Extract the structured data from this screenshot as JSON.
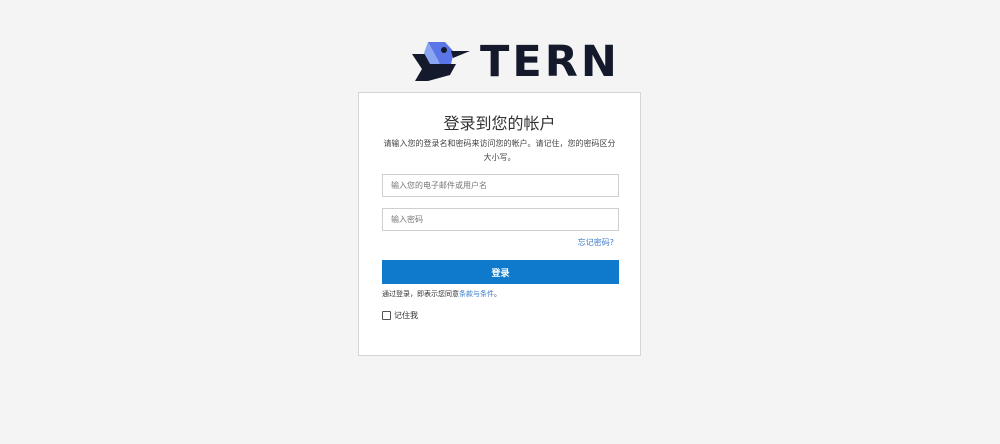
{
  "brand": {
    "name": "TERN",
    "colors": {
      "dark": "#14192b",
      "blue": "#5a76e6",
      "light_blue": "#8aa6f2"
    }
  },
  "card": {
    "title": "登录到您的帐户",
    "subtitle": "请输入您的登录名和密码来访问您的帐户。请记住，您的密码区分大小写。"
  },
  "form": {
    "email_placeholder": "输入您的电子邮件或用户名",
    "email_value": "",
    "password_placeholder": "输入密码",
    "password_value": "",
    "forgot_link": "忘记密码?",
    "login_button": "登录",
    "terms_prefix": "通过登录，即表示您同意",
    "terms_link": "条款与条件",
    "terms_suffix": "。",
    "remember_label": "记住我",
    "remember_checked": false
  },
  "colors": {
    "background": "#f4f4f4",
    "primary_button": "#0f7acc",
    "link": "#3a7bc8"
  }
}
